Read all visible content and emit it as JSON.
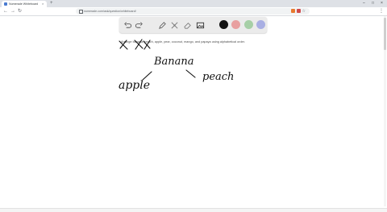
{
  "browser": {
    "tab_title": "Numerade Whiteboard",
    "tab_close": "×",
    "new_tab": "+",
    "url": "numerade.com/ask/question/whiteboard/",
    "window_minimize": "–",
    "window_maximize": "□",
    "window_close": "×",
    "back": "←",
    "forward": "→",
    "reload": "↻",
    "menu": "⋮",
    "star": "☆"
  },
  "whiteboard": {
    "tools": [
      "undo-icon",
      "redo-icon",
      "pen-icon",
      "tools-icon",
      "eraser-icon",
      "image-icon"
    ],
    "colors": [
      "#111111",
      "#e8a0a0",
      "#a6cfa6",
      "#a9afe3"
    ]
  },
  "question": {
    "text": "Arrange banana, peach, apple, pear, coconut, mango, and papaya using alphabetical order."
  },
  "handwriting": {
    "root": "Banana",
    "left": "apple",
    "right": "peach"
  }
}
